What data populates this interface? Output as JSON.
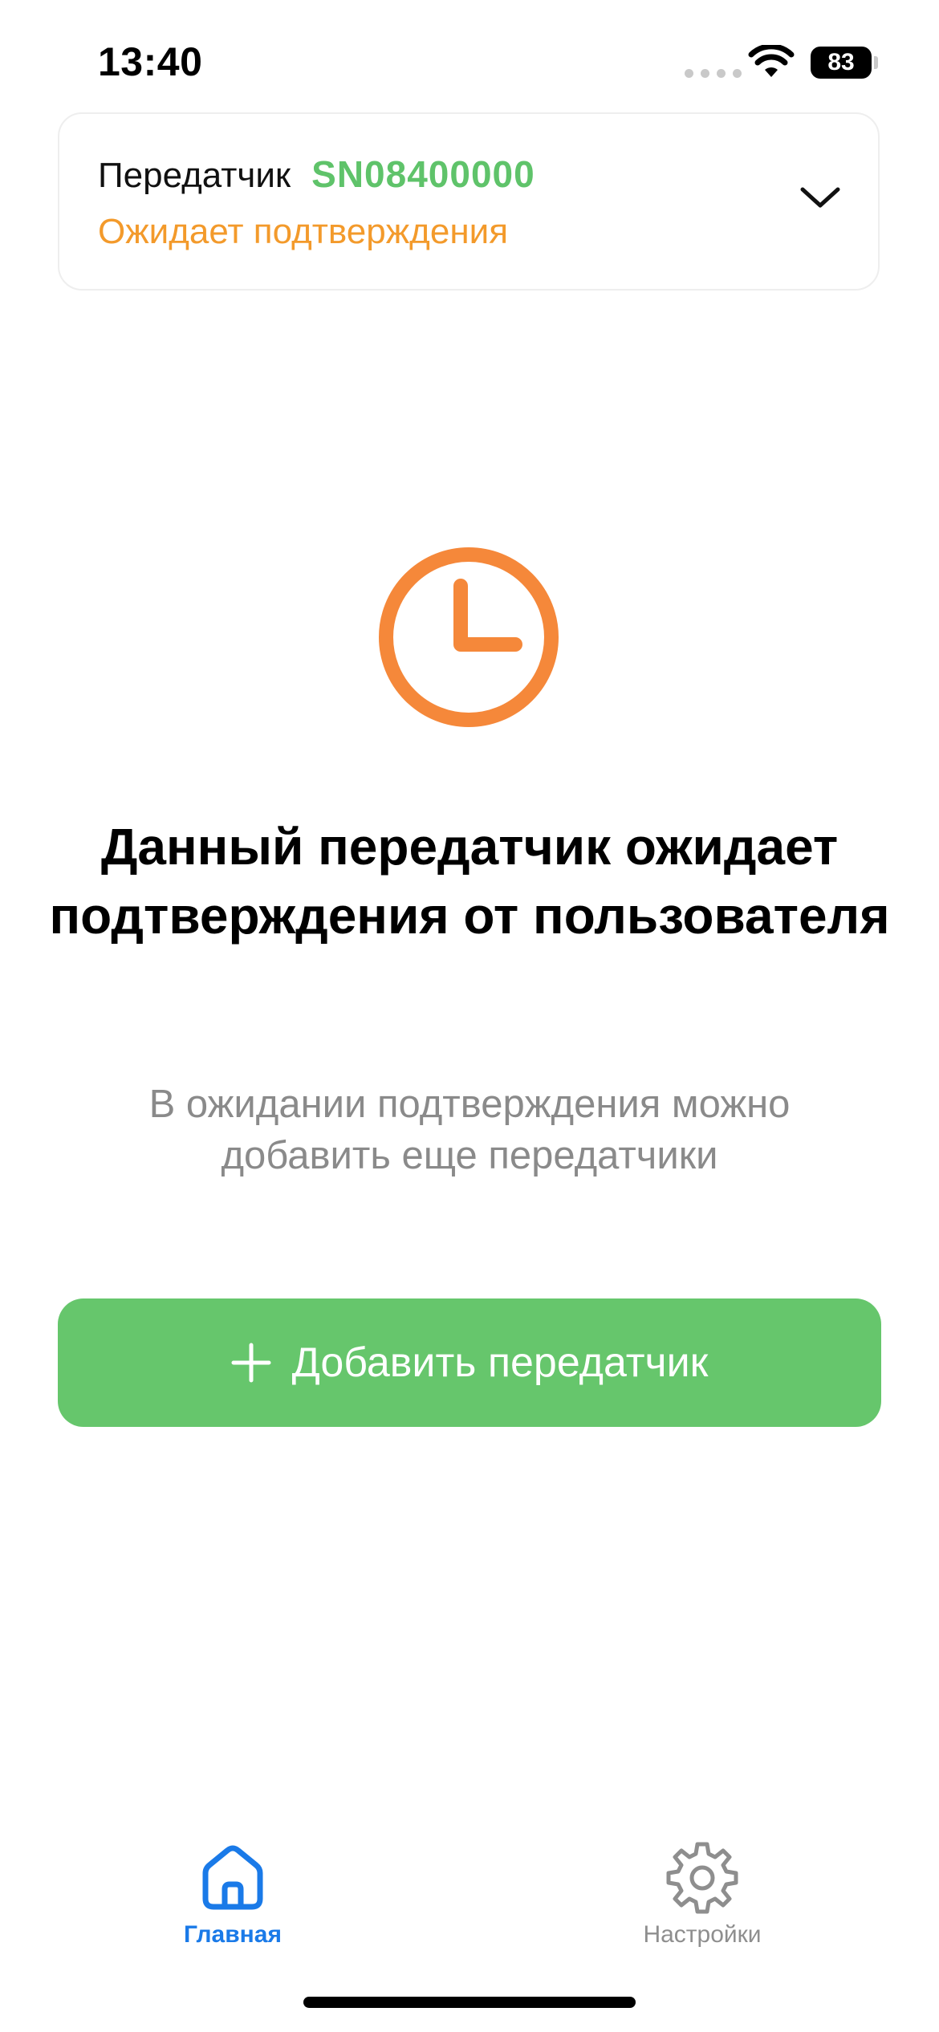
{
  "status_bar": {
    "time": "13:40",
    "battery_level": "83",
    "icons": [
      "signal-dots-icon",
      "wifi-icon",
      "battery-icon"
    ]
  },
  "transmitter_card": {
    "label": "Передатчик",
    "serial": "SN08400000",
    "status": "Ожидает подтверждения",
    "expand_icon": "chevron-down-icon"
  },
  "main": {
    "icon": "clock-icon",
    "title": "Данный передатчик ожидает подтверждения от пользователя",
    "subtitle": "В ожидании подтверждения можно добавить еще передатчики",
    "add_button": {
      "icon": "plus-icon",
      "label": "Добавить передатчик"
    }
  },
  "tab_bar": {
    "tabs": [
      {
        "label": "Главная",
        "icon": "home-icon",
        "active": true
      },
      {
        "label": "Настройки",
        "icon": "gear-icon",
        "active": false
      }
    ]
  },
  "colors": {
    "accent_green": "#66c66c",
    "serial_green": "#5fc36a",
    "status_orange": "#f39a2b",
    "clock_orange": "#f5883a",
    "active_tab_blue": "#1a7ae8",
    "inactive_gray": "#8e8e8e"
  }
}
